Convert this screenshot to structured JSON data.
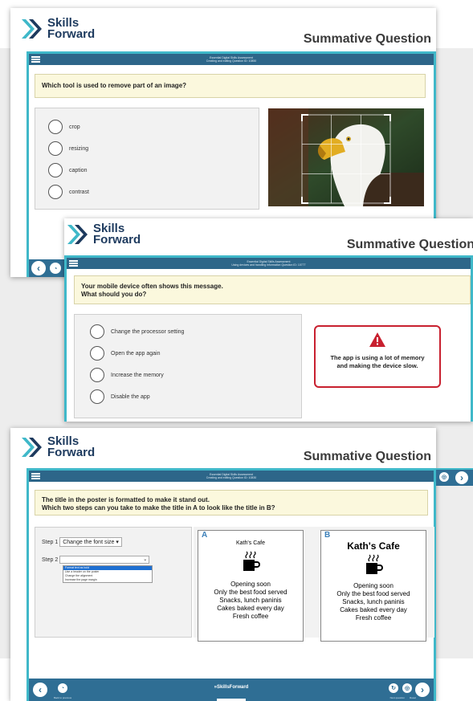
{
  "brand": {
    "line1": "Skills",
    "line2": "Forward",
    "footer_brand": "SkillsForward"
  },
  "header_title": "Summative Question",
  "colors": {
    "frame_blue": "#2f6e94",
    "frame_border": "#3fb8c9",
    "question_bg": "#fbf8dd",
    "warning_red": "#c8202f"
  },
  "screen1": {
    "topbar_line1": "Essential Digital Skills Assessment",
    "topbar_line2": "Creating and editing Question ID: 10850",
    "question": "Which tool is used to remove part of an image?",
    "options": [
      "crop",
      "resizing",
      "caption",
      "contrast"
    ],
    "image_icon": "eagle-photo-with-crop-grid"
  },
  "screen2": {
    "topbar_line1": "Essential Digital Skills Assessment",
    "topbar_line2": "Using devices and handling information Question ID: 10777",
    "question_line1": "Your mobile device often shows this message.",
    "question_line2": "What should you do?",
    "options": [
      "Change the processor setting",
      "Open the app again",
      "Increase the memory",
      "Disable the app"
    ],
    "warning_line1": "The app is using a lot of memory",
    "warning_line2": "and making the device slow."
  },
  "screen3": {
    "topbar_line1": "Essential Digital Skills Assessment",
    "topbar_line2": "Creating and editing Question ID: 10830",
    "question_line1": "The title in the poster is formatted to make it stand out.",
    "question_line2": "Which two steps can you take to make the title in A to look like the title in B?",
    "step1_label": "Step 1",
    "step1_value": "Change the font size",
    "step2_label": "Step 2",
    "step2_value": "",
    "dropdown_options": [
      "Format text as bold",
      "Use a header on the poster",
      "Change the alignment",
      "Increase the page margin"
    ],
    "poster_a": {
      "letter": "A",
      "title": "Kath's Cafe",
      "lines": [
        "Opening soon",
        "Only the best food served",
        "Snacks, lunch paninis",
        "Cakes baked every day",
        "Fresh coffee"
      ]
    },
    "poster_b": {
      "letter": "B",
      "title": "Kath's Cafe",
      "lines": [
        "Opening soon",
        "Only the best food served",
        "Snacks, lunch paninis",
        "Cakes baked every day",
        "Fresh coffee"
      ]
    },
    "footer_left_caption": "Back to previous",
    "footer_right_caption1": "Next question",
    "footer_right_caption2": "Reset"
  }
}
